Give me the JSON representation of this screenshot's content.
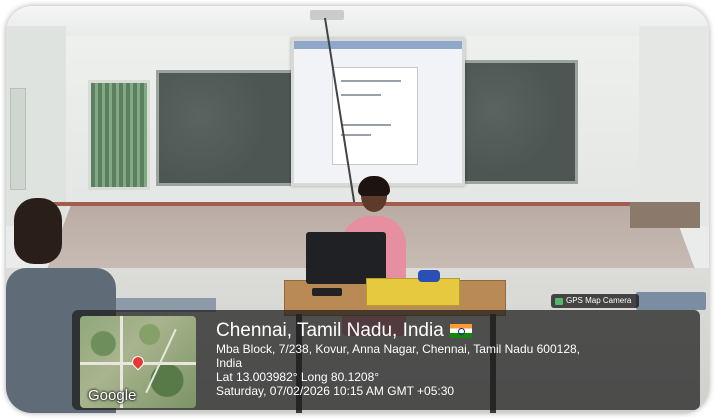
{
  "scene": {
    "description_free": true,
    "accent_colors": {
      "saree": "#e58fa0",
      "table": "#b98a55",
      "overlay": "#1e1e1e"
    }
  },
  "gps_camera": {
    "badge_label": "GPS Map Camera",
    "map_watermark": "Google",
    "city": "Chennai, Tamil Nadu, India",
    "address_line_1": "Mba Block, 7/238, Kovur, Anna Nagar, Chennai, Tamil Nadu 600128,",
    "address_line_2": "India",
    "coordinates": "Lat 13.003982° Long 80.1208°",
    "datetime": "Saturday, 07/02/2026 10:15 AM GMT +05:30",
    "flag_icon": "india-flag-icon",
    "pin_icon": "map-pin-icon"
  }
}
